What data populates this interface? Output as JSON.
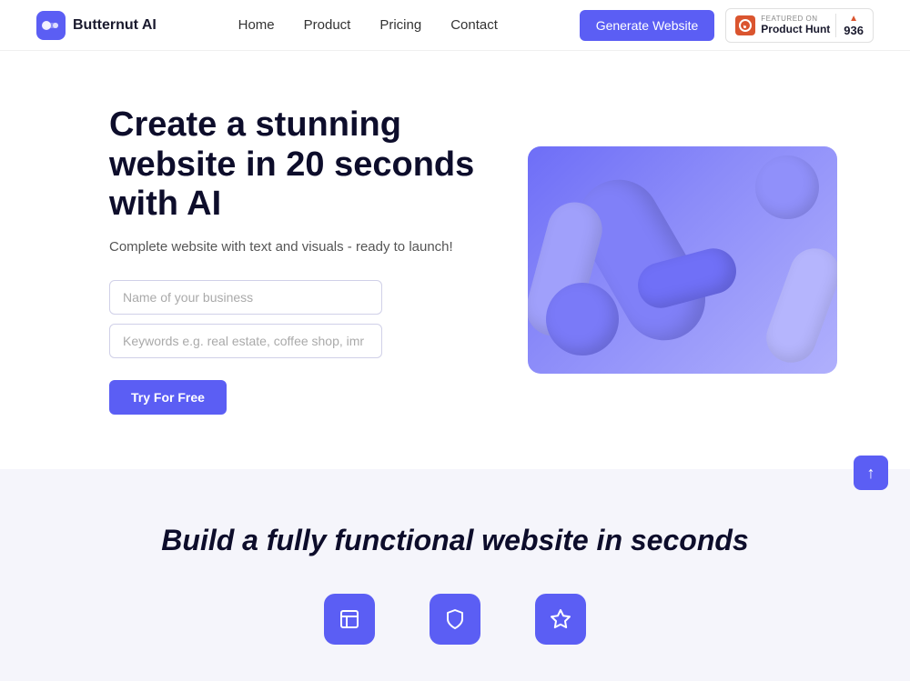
{
  "nav": {
    "logo_text": "Butternut AI",
    "links": [
      {
        "label": "Home",
        "key": "home"
      },
      {
        "label": "Product",
        "key": "product"
      },
      {
        "label": "Pricing",
        "key": "pricing"
      },
      {
        "label": "Contact",
        "key": "contact"
      }
    ],
    "generate_btn": "Generate Website",
    "product_hunt": {
      "featured_label": "FEATURED ON",
      "name": "Product Hunt",
      "score": "936"
    }
  },
  "hero": {
    "title": "Create a stunning website in 20 seconds with AI",
    "subtitle": "Complete website with text and visuals - ready to launch!",
    "input_name_placeholder": "Name of your business",
    "input_keywords_placeholder": "Keywords e.g. real estate, coffee shop, imr",
    "cta_btn": "Try For Free"
  },
  "section2": {
    "title_pre": "Build a",
    "title_highlight": "fully functional",
    "title_post": "website in seconds",
    "cards": [
      {
        "icon": "layout-icon",
        "unicode": "⬛"
      },
      {
        "icon": "shield-icon",
        "unicode": "⬛"
      },
      {
        "icon": "star-icon",
        "unicode": "⬛"
      }
    ]
  },
  "scroll_top": {
    "icon": "chevron-up-icon",
    "symbol": "↑"
  }
}
